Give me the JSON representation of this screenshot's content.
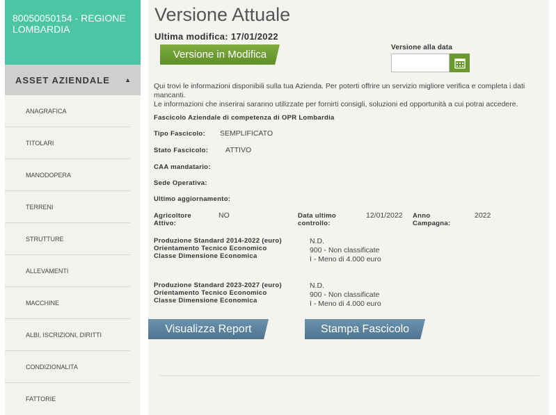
{
  "sidebar": {
    "org_name": "80050050154 - REGIONE LOMBARDIA",
    "section_label": "ASSET AZIENDALE",
    "section_caret": "▲",
    "items": [
      {
        "label": "ANAGRAFICA"
      },
      {
        "label": "TITOLARI"
      },
      {
        "label": "MANODOPERA"
      },
      {
        "label": "TERRENI"
      },
      {
        "label": "STRUTTURE"
      },
      {
        "label": "ALLEVAMENTI"
      },
      {
        "label": "MACCHINE"
      },
      {
        "label": "ALBI, ISCRIZIONI, DIRITTI"
      },
      {
        "label": "CONDIZIONALITA"
      },
      {
        "label": "FATTORIE"
      }
    ]
  },
  "main": {
    "title": "Versione Attuale",
    "last_modified": "Ultima modifica: 17/01/2022",
    "edit_button": "Versione in Modifica",
    "date_label": "Versione alla data",
    "date_value": "",
    "intro_line1": "Qui trovi le informazioni disponibili sulla tua Azienda. Per poterti offrire un servizio migliore verifica e completa i dati mancanti.",
    "intro_line2": "Le informazioni che inserirai saranno utilizzate per fornirti consigli, soluzioni ed opportunità a cui potrai accedere.",
    "dossier_heading": "Fascicolo Aziendale di competenza di OPR Lombardia",
    "fields": {
      "tipo_label": "Tipo Fascicolo:",
      "tipo_value": "SEMPLIFICATO",
      "stato_label": "Stato Fascicolo:",
      "stato_value": "ATTIVO",
      "caa_label": "CAA mandatario:",
      "sede_label": "Sede Operativa:",
      "ultimo_label": "Ultimo aggiornamento:",
      "agricoltore_label": "Agricoltore Attivo:",
      "agricoltore_value": "NO",
      "controllo_label": "Data ultimo controllo:",
      "controllo_value": "12/01/2022",
      "anno_label": "Anno Campagna:",
      "anno_value": "2022"
    },
    "ps_2014": {
      "label1": "Produzione Standard 2014-2022 (euro)",
      "label2": "Orientamento Tecnico Economico",
      "label3": "Classe Dimensione Economica",
      "value1": "N.D.",
      "value2": "900 - Non classificate",
      "value3": "I - Meno di 4.000 euro"
    },
    "ps_2023": {
      "label1": "Produzione Standard 2023-2027 (euro)",
      "label2": "Orientamento Tecnico Economico",
      "label3": "Classe Dimensione Economica",
      "value1": "N.D.",
      "value2": "900 - Non classificate",
      "value3": "I - Meno di 4.000 euro"
    },
    "report_button": "Visualizza Report",
    "print_button": "Stampa Fascicolo"
  },
  "colors": {
    "header_green": "#4cc5a4",
    "button_green": "#6a9a2e",
    "button_blue": "#5a849e"
  }
}
